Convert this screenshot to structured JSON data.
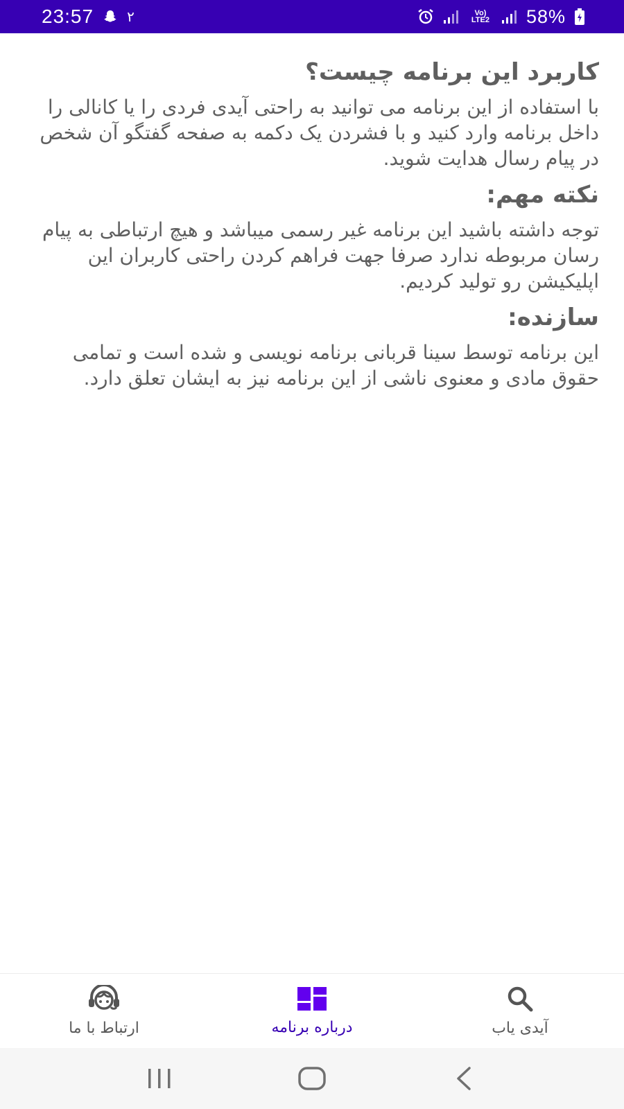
{
  "status_bar": {
    "time": "23:57",
    "notification_count": "۲",
    "network": "Vo) LTE2",
    "battery_percent": "58%",
    "background_color": "#3700b3",
    "icons": [
      "snapchat-icon",
      "alarm-icon",
      "signal-icon",
      "volte-icon",
      "signal-icon",
      "battery-charging-icon"
    ]
  },
  "content": {
    "sections": [
      {
        "heading": "کاربرد این برنامه چیست؟",
        "body": "با استفاده از این برنامه می توانید به راحتی آیدی فردی را یا کانالی را داخل برنامه وارد کنید و با فشردن یک دکمه به صفحه گفتگو آن شخص در پیام رسال هدایت شوید."
      },
      {
        "heading": "نکته مهم:",
        "body": "توجه داشته باشید این برنامه غیر رسمی میباشد و هیچ ارتباطی به پیام رسان مربوطه ندارد صرفا جهت فراهم کردن راحتی کاربران این اپلیکیشن رو تولید کردیم."
      },
      {
        "heading": "سازنده:",
        "body": "این برنامه توسط سینا قربانی برنامه نویسی و شده است و تمامی حقوق مادی و معنوی ناشی از این برنامه نیز به ایشان تعلق دارد."
      }
    ]
  },
  "bottom_nav": {
    "active_color": "#6200ee",
    "items": [
      {
        "label": "ارتباط با ما",
        "icon": "support-agent-icon",
        "active": false
      },
      {
        "label": "درباره برنامه",
        "icon": "dashboard-icon",
        "active": true
      },
      {
        "label": "آیدی یاب",
        "icon": "search-icon",
        "active": false
      }
    ]
  },
  "system_nav": {
    "icons": [
      "recent-apps-icon",
      "home-icon",
      "back-icon"
    ]
  }
}
